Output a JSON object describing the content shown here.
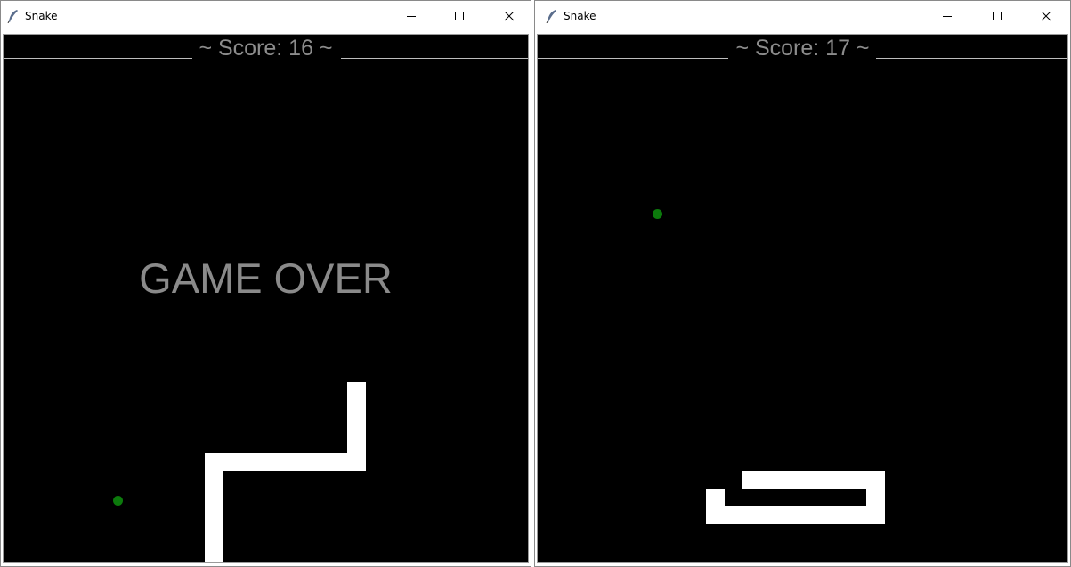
{
  "windows": [
    {
      "title": "Snake",
      "score_label": "~ Score: 16 ~",
      "game_over_text": "GAME OVER",
      "state": "game-over"
    },
    {
      "title": "Snake",
      "score_label": "~ Score: 17 ~",
      "state": "playing"
    }
  ],
  "colors": {
    "canvas_bg": "#000000",
    "snake": "#ffffff",
    "food": "#0c7a0c",
    "text": "#8c8c8c"
  },
  "icons": {
    "app": "feather-icon",
    "minimize": "minimize-icon",
    "maximize": "maximize-icon",
    "close": "close-icon"
  }
}
